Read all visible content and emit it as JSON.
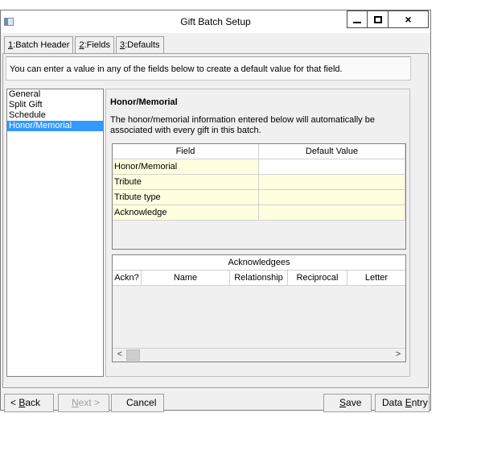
{
  "window": {
    "title": "Gift Batch Setup",
    "close_glyph": "×",
    "min_icon": "minimize-icon",
    "max_icon": "maximize-icon"
  },
  "tabs": [
    {
      "key": "1",
      "label": "Batch Header"
    },
    {
      "key": "2",
      "label": "Fields"
    },
    {
      "key": "3",
      "label": "Defaults",
      "active": true
    }
  ],
  "instruction": "You can enter a value in any of the fields below to create a default value for that field.",
  "sections": [
    "General",
    "Split Gift",
    "Schedule",
    "Honor/Memorial"
  ],
  "selected_section": "Honor/Memorial",
  "panel": {
    "title": "Honor/Memorial",
    "description": "The honor/memorial information entered below will automatically be associated with every gift in this batch.",
    "fields_grid": {
      "headers": [
        "Field",
        "Default Value"
      ],
      "rows": [
        {
          "field": "Honor/Memorial",
          "value": ""
        },
        {
          "field": "Tribute",
          "value": ""
        },
        {
          "field": "Tribute type",
          "value": ""
        },
        {
          "field": "Acknowledge",
          "value": ""
        }
      ]
    },
    "acknowledgees": {
      "title": "Acknowledgees",
      "headers": [
        "Ackn?",
        "Name",
        "Relationship",
        "Reciprocal",
        "Letter"
      ],
      "left_arrow": "<",
      "right_arrow": ">"
    }
  },
  "buttons": {
    "back": {
      "prefix": "< ",
      "key": "B",
      "rest": "ack"
    },
    "next": {
      "key": "N",
      "rest": "ext >"
    },
    "cancel": "Cancel",
    "save": {
      "key": "S",
      "rest": "ave"
    },
    "data_entry": {
      "prefix": "Data ",
      "key": "E",
      "rest": "ntry"
    }
  }
}
